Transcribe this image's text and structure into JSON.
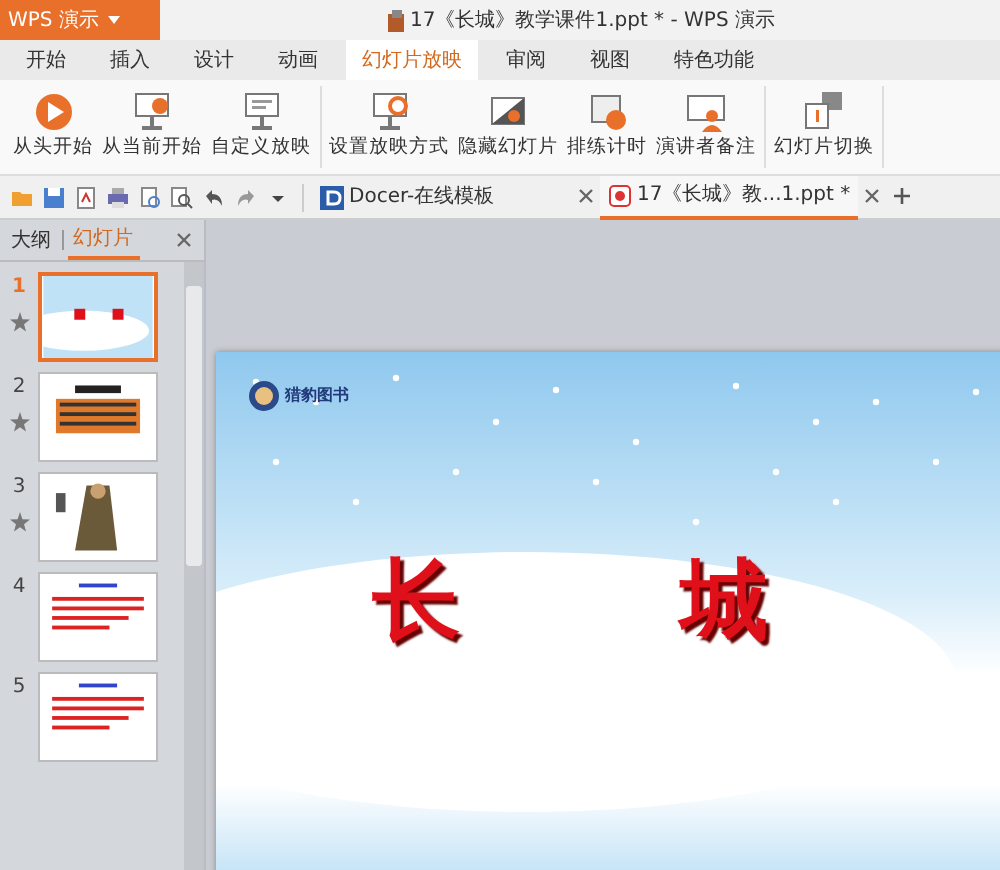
{
  "app_menu": {
    "label": "WPS 演示"
  },
  "window": {
    "title": "17《长城》教学课件1.ppt * - WPS 演示"
  },
  "ribbon_tabs": [
    {
      "label": "开始",
      "selected": false
    },
    {
      "label": "插入",
      "selected": false
    },
    {
      "label": "设计",
      "selected": false
    },
    {
      "label": "动画",
      "selected": false
    },
    {
      "label": "幻灯片放映",
      "selected": true
    },
    {
      "label": "审阅",
      "selected": false
    },
    {
      "label": "视图",
      "selected": false
    },
    {
      "label": "特色功能",
      "selected": false
    }
  ],
  "ribbon_groups": [
    [
      {
        "label": "从头开始",
        "kind": "play"
      },
      {
        "label": "从当前开始",
        "kind": "screen-play"
      },
      {
        "label": "自定义放映",
        "kind": "screen"
      }
    ],
    [
      {
        "label": "设置放映方式",
        "kind": "screen-gear"
      },
      {
        "label": "隐藏幻灯片",
        "kind": "hide"
      },
      {
        "label": "排练计时",
        "kind": "timer"
      },
      {
        "label": "演讲者备注",
        "kind": "notes"
      }
    ],
    [
      {
        "label": "幻灯片切换",
        "kind": "transition"
      }
    ]
  ],
  "quick_access": [
    {
      "kind": "open"
    },
    {
      "kind": "save"
    },
    {
      "kind": "pdf"
    },
    {
      "kind": "print"
    },
    {
      "kind": "print-preview"
    },
    {
      "kind": "preview"
    },
    {
      "kind": "undo"
    },
    {
      "kind": "redo"
    },
    {
      "kind": "dropdown"
    }
  ],
  "document_tabs": [
    {
      "label": "Docer-在线模板",
      "kind": "docer",
      "selected": false
    },
    {
      "label": "17《长城》教...1.ppt *",
      "kind": "ppt",
      "selected": true
    }
  ],
  "panel_tabs": [
    {
      "label": "大纲",
      "selected": false
    },
    {
      "label": "幻灯片",
      "selected": true
    }
  ],
  "slides": [
    {
      "number": "1",
      "selected": true,
      "animated": true,
      "kind": "title"
    },
    {
      "number": "2",
      "selected": false,
      "animated": true,
      "kind": "text-dark"
    },
    {
      "number": "3",
      "selected": false,
      "animated": true,
      "kind": "picture"
    },
    {
      "number": "4",
      "selected": false,
      "animated": false,
      "kind": "text-red"
    },
    {
      "number": "5",
      "selected": false,
      "animated": false,
      "kind": "text-red"
    }
  ],
  "slide": {
    "logo_text": "猎豹图书",
    "title_parts": [
      "长",
      "城"
    ]
  }
}
